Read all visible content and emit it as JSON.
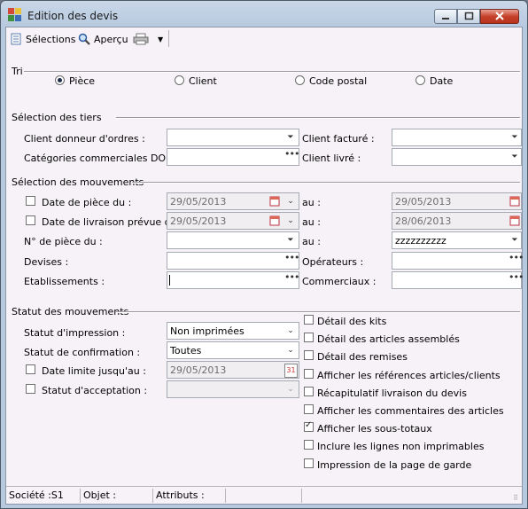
{
  "window": {
    "title": "Edition des devis",
    "controls": {
      "minimize": "–",
      "maximize": "□",
      "close": "✕"
    }
  },
  "toolbar": {
    "selections": "Sélections",
    "apercu": "Aperçu",
    "print_menu_arrow": "▼"
  },
  "tri": {
    "label": "Tri",
    "options": [
      {
        "label": "Pièce",
        "selected": true
      },
      {
        "label": "Client",
        "selected": false
      },
      {
        "label": "Code postal",
        "selected": false
      },
      {
        "label": "Date",
        "selected": false
      }
    ]
  },
  "tiers": {
    "title": "Sélection des tiers",
    "client_donneur": {
      "label": "Client donneur d'ordres :",
      "value": ""
    },
    "client_facture": {
      "label": "Client facturé :",
      "value": ""
    },
    "categories": {
      "label": "Catégories commerciales DO :",
      "value": ""
    },
    "client_livre": {
      "label": "Client livré :",
      "value": ""
    }
  },
  "mouvements": {
    "title": "Sélection des mouvements",
    "date_piece": {
      "label": "Date de pièce du :",
      "checked": false,
      "from": "29/05/2013",
      "au_label": "au :",
      "to": "29/05/2013"
    },
    "date_livraison": {
      "label": "Date de livraison prévue du :",
      "checked": false,
      "from": "29/05/2013",
      "au_label": "au :",
      "to": "28/06/2013"
    },
    "numero_piece": {
      "label": "N° de pièce du :",
      "from": "",
      "au_label": "au :",
      "to": "zzzzzzzzzz"
    },
    "devises": {
      "label": "Devises :",
      "value": ""
    },
    "operateurs": {
      "label": "Opérateurs :",
      "value": ""
    },
    "etablissements": {
      "label": "Etablissements :",
      "value": ""
    },
    "commerciaux": {
      "label": "Commerciaux :",
      "value": ""
    }
  },
  "statut": {
    "title": "Statut des mouvements",
    "impression": {
      "label": "Statut d'impression :",
      "value": "Non imprimées"
    },
    "confirmation": {
      "label": "Statut de confirmation :",
      "value": "Toutes"
    },
    "date_limite": {
      "label": "Date limite jusqu'au :",
      "checked": false,
      "value": "29/05/2013",
      "cal_day": "31"
    },
    "acceptation": {
      "label": "Statut d'acceptation :",
      "checked": false,
      "value": ""
    }
  },
  "options": [
    {
      "label": "Détail des kits",
      "checked": false
    },
    {
      "label": "Détail des articles assemblés",
      "checked": false
    },
    {
      "label": "Détail des remises",
      "checked": false
    },
    {
      "label": "Afficher les références articles/clients",
      "checked": false
    },
    {
      "label": "Récapitulatif livraison du devis",
      "checked": false
    },
    {
      "label": "Afficher les commentaires des articles",
      "checked": false
    },
    {
      "label": "Afficher les sous-totaux",
      "checked": true
    },
    {
      "label": "Inclure les lignes non imprimables",
      "checked": false
    },
    {
      "label": "Impression de la page de garde",
      "checked": false
    }
  ],
  "statusbar": {
    "societe": "Société :S1",
    "objet": "Objet :",
    "attributs": "Attributs :"
  },
  "colors": {
    "title_bg": "#c0d0e4",
    "client_bg": "#f6f2f7",
    "close_red": "#c6412a"
  }
}
